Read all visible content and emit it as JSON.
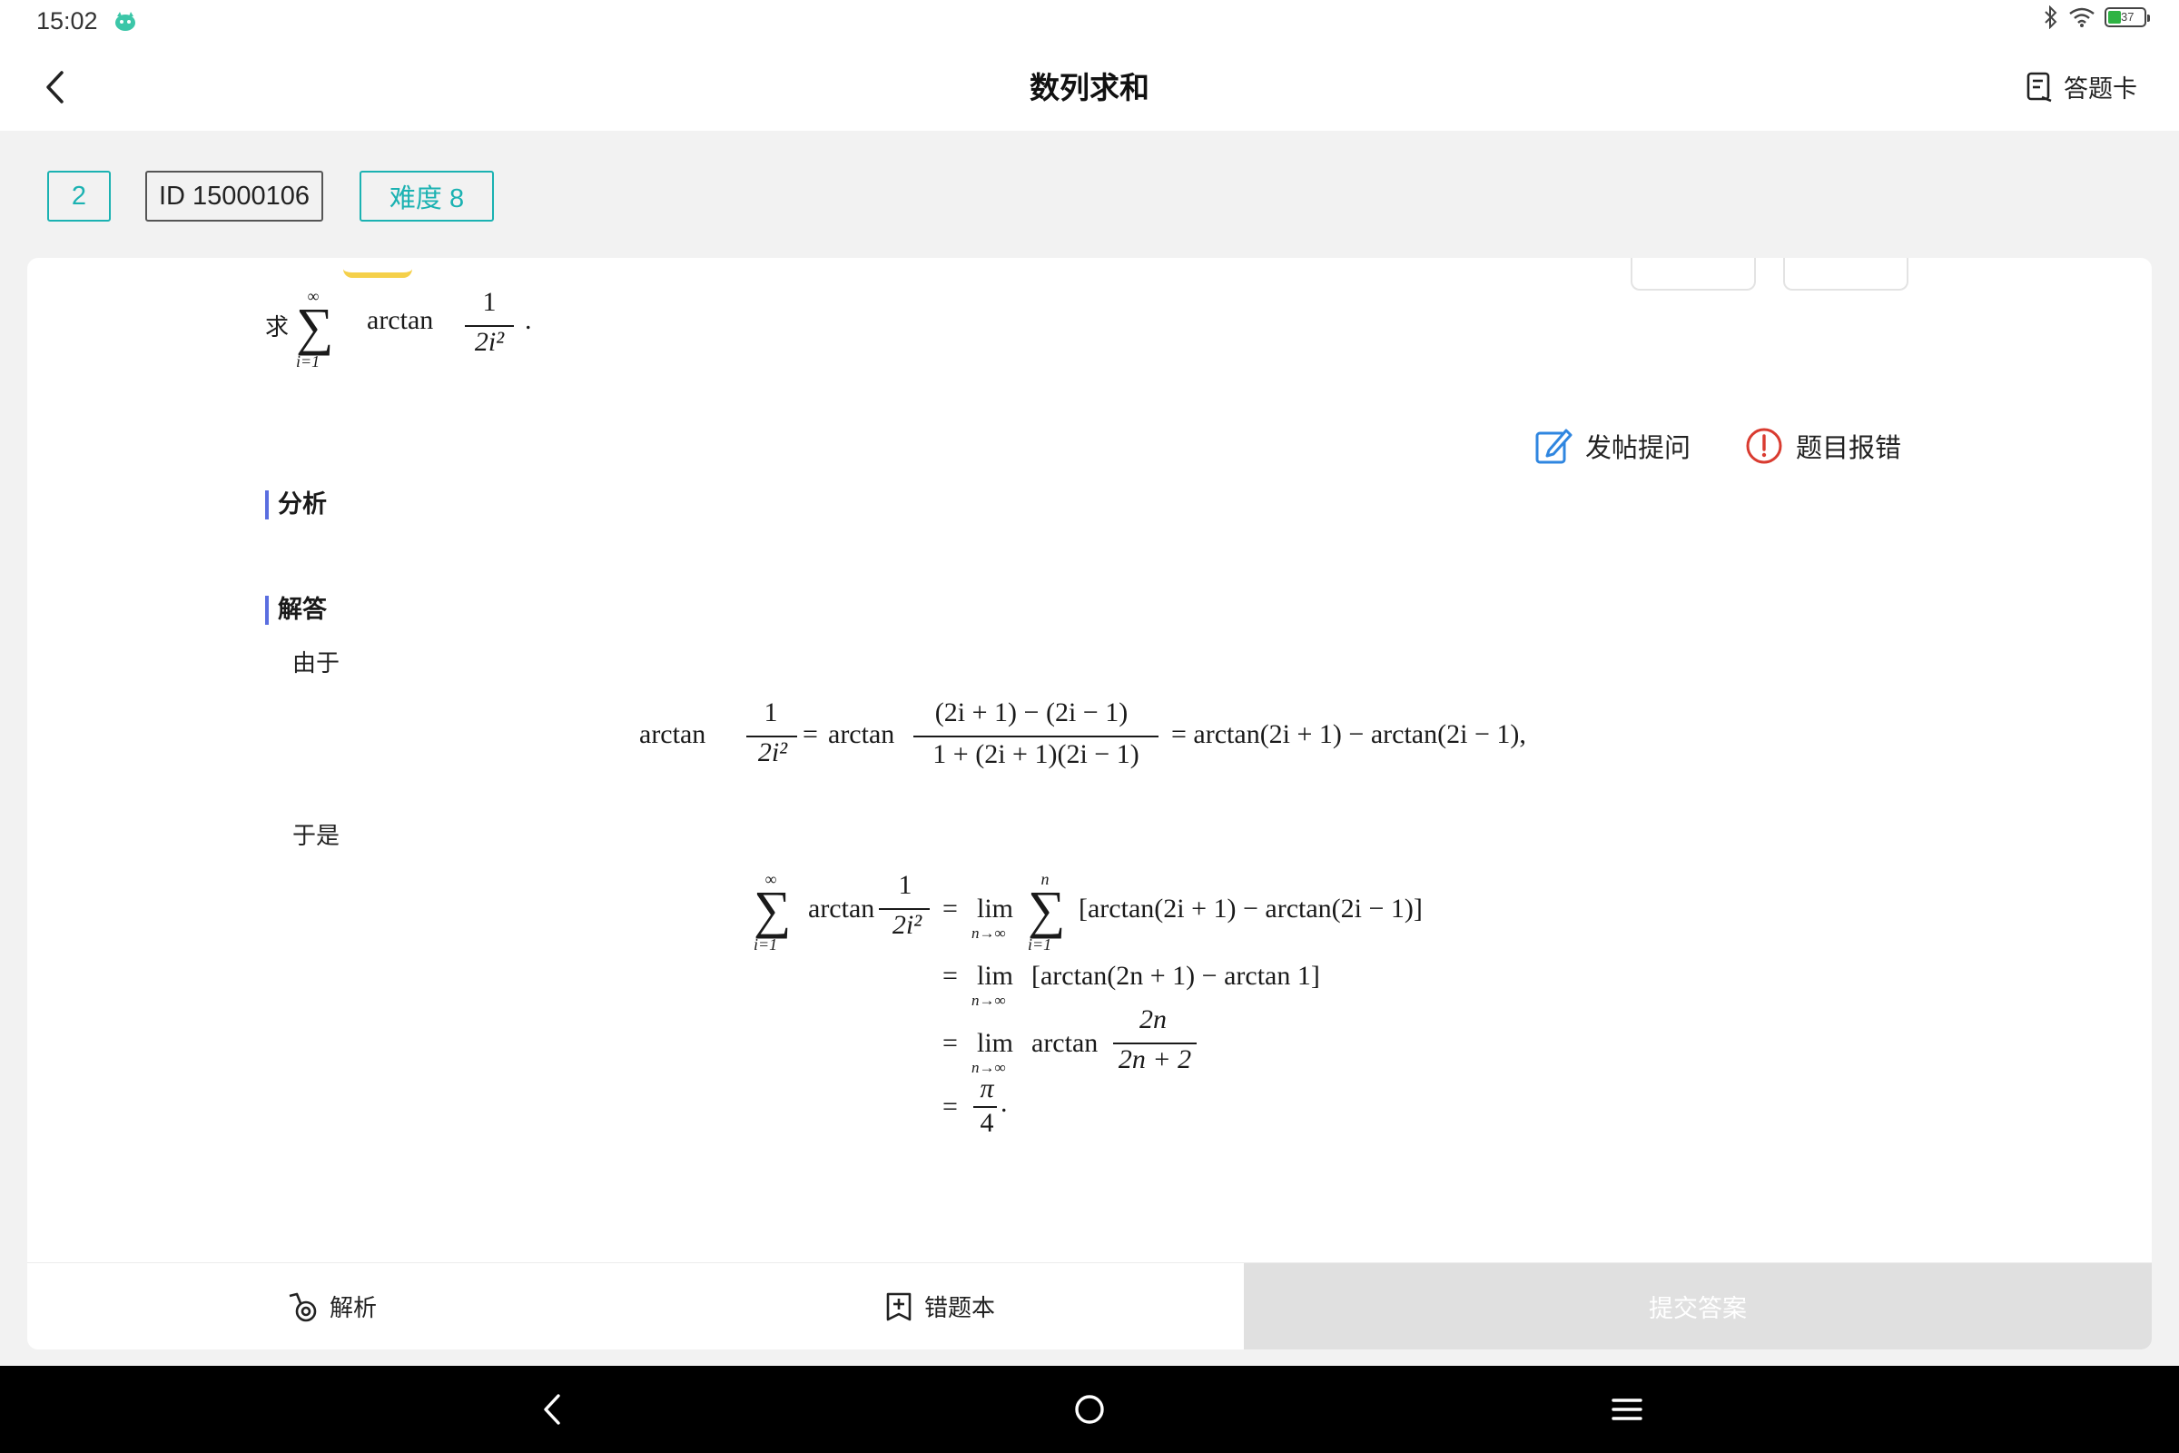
{
  "status": {
    "time": "15:02",
    "battery_level": "37",
    "battery_fraction": 0.37,
    "icons": [
      "bluetooth-icon",
      "wifi-icon",
      "battery-icon"
    ]
  },
  "header": {
    "title": "数列求和",
    "answer_card_label": "答题卡"
  },
  "tags": {
    "number": "2",
    "id": "ID 15000106",
    "difficulty": "难度 8"
  },
  "actions": {
    "post_question": "发帖提问",
    "report_error": "题目报错"
  },
  "problem": {
    "prefix": "求",
    "sum_upper": "∞",
    "sum_lower": "i=1",
    "func": "arctan",
    "numerator": "1",
    "denominator": "2i²",
    "suffix": "."
  },
  "sections": {
    "analysis": "分析",
    "solution": "解答"
  },
  "solution": {
    "since": "由于",
    "therefore": "于是",
    "eq1": {
      "lhs_func": "arctan",
      "lhs_num": "1",
      "lhs_den": "2i²",
      "eq": "=",
      "mid_func": "arctan",
      "mid_num": "(2i + 1) − (2i − 1)",
      "mid_den": "1 + (2i + 1)(2i − 1)",
      "rhs": "= arctan(2i + 1) − arctan(2i − 1),"
    },
    "eq2": {
      "sum_upper": "∞",
      "sum_lower": "i=1",
      "func": "arctan",
      "num": "1",
      "den": "2i²",
      "line1_lim": "lim",
      "line1_lim_sub": "n→∞",
      "line1_sum_upper": "n",
      "line1_sum_lower": "i=1",
      "line1_body": "[arctan(2i + 1) − arctan(2i − 1)]",
      "line2_body": "[arctan(2n + 1) − arctan 1]",
      "line3_func": "arctan",
      "line3_num": "2n",
      "line3_den": "2n + 2",
      "line4_num": "π",
      "line4_den": "4",
      "line4_end": "."
    }
  },
  "bottom": {
    "analysis": "解析",
    "notebook": "错题本",
    "submit": "提交答案"
  },
  "colors": {
    "teal": "#1bb2b2",
    "accent_blue": "#2f86e0",
    "error_red": "#d93b30",
    "section_bar": "#5a6ee0"
  }
}
